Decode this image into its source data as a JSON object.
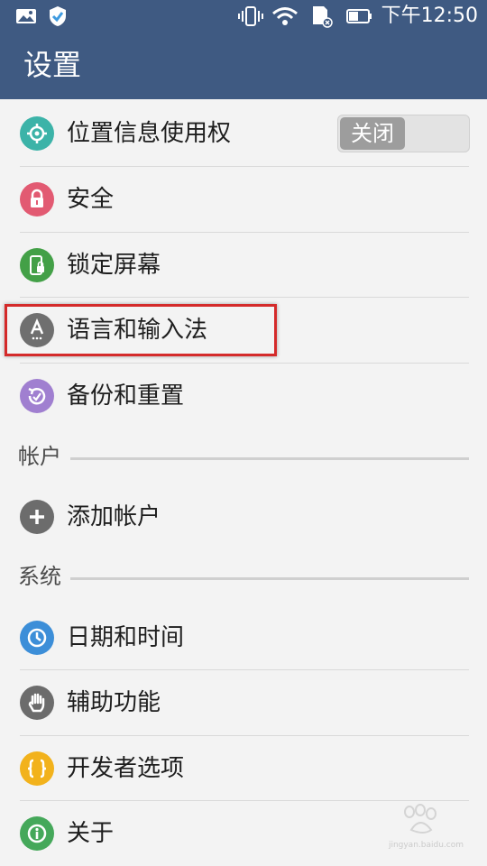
{
  "status_bar": {
    "time": "下午12:50",
    "icons": [
      "gallery-icon",
      "shield-icon",
      "vibrate-icon",
      "wifi-icon",
      "sd-card-icon",
      "battery-icon"
    ]
  },
  "app_bar": {
    "title": "设置"
  },
  "colors": {
    "header": "#3f5a82",
    "location": "#3cb3a8",
    "security": "#e25a72",
    "lock_screen": "#43a047",
    "language": "#6f6f6f",
    "backup": "#a07fd0",
    "add_account": "#6c6c6c",
    "date_time": "#3c8ed8",
    "accessibility": "#6c6c6c",
    "developer": "#f2b21c",
    "about": "#45a85a",
    "highlight": "#d42a2a"
  },
  "items": {
    "location": {
      "label": "位置信息使用权",
      "icon": "location-target-icon",
      "toggle_label": "关闭"
    },
    "security": {
      "label": "安全",
      "icon": "lock-icon"
    },
    "lock_screen": {
      "label": "锁定屏幕",
      "icon": "phone-lock-icon"
    },
    "language": {
      "label": "语言和输入法",
      "icon": "language-a-icon"
    },
    "backup": {
      "label": "备份和重置",
      "icon": "backup-restore-icon"
    },
    "add_account": {
      "label": "添加帐户",
      "icon": "plus-icon"
    },
    "date_time": {
      "label": "日期和时间",
      "icon": "clock-icon"
    },
    "accessibility": {
      "label": "辅助功能",
      "icon": "hand-icon"
    },
    "developer": {
      "label": "开发者选项",
      "icon": "braces-icon"
    },
    "about": {
      "label": "关于",
      "icon": "info-icon"
    }
  },
  "sections": {
    "accounts": "帐户",
    "system": "系统"
  },
  "watermark": {
    "text": "jingyan.baidu.com"
  }
}
